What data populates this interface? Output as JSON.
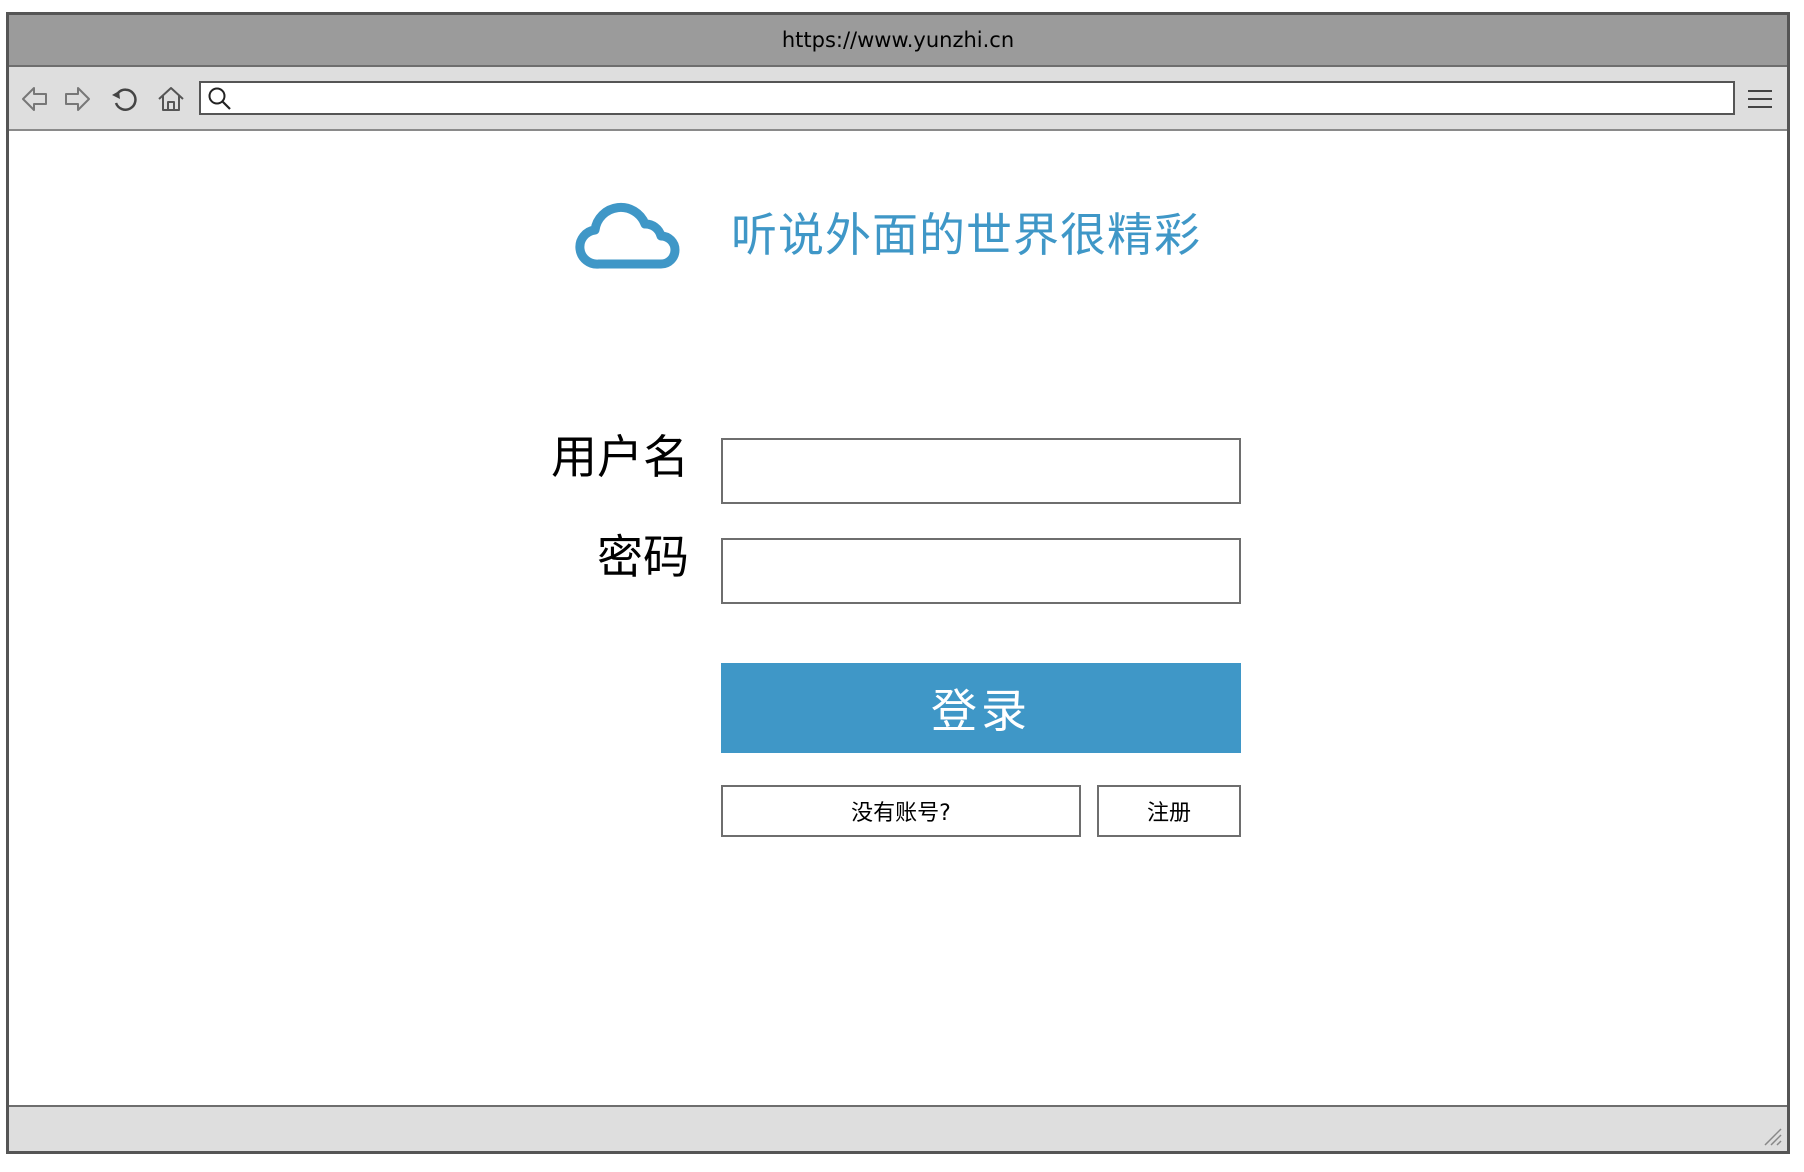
{
  "window": {
    "url": "https://www.yunzhi.cn"
  },
  "toolbar": {
    "back_icon": "back-arrow-icon",
    "forward_icon": "forward-arrow-icon",
    "reload_icon": "reload-icon",
    "home_icon": "home-icon",
    "search_icon": "search-icon",
    "menu_icon": "hamburger-menu-icon",
    "address_value": ""
  },
  "brand": {
    "logo_icon": "cloud-icon",
    "slogan": "听说外面的世界很精彩",
    "color": "#3f97c7"
  },
  "login_form": {
    "username_label": "用户名",
    "username_value": "",
    "password_label": "密码",
    "password_value": "",
    "login_button": "登录",
    "no_account_button": "没有账号?",
    "register_button": "注册"
  },
  "colors": {
    "accent": "#3f97c7",
    "titlebar": "#9b9b9b",
    "toolbar": "#dedede",
    "frame": "#555555"
  }
}
